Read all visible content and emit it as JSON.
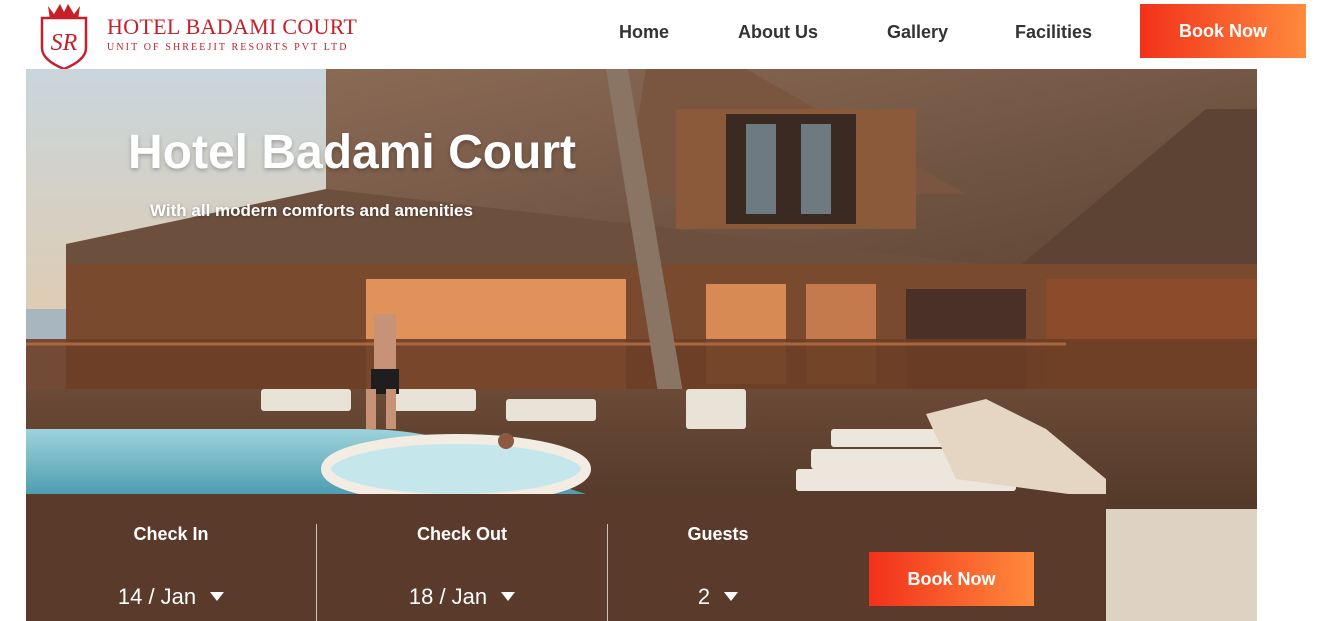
{
  "brand": {
    "name": "HOTEL BADAMI COURT",
    "tagline": "UNIT  OF SHREEJIT RESORTS PVT LTD",
    "logo_color": "#c8202a"
  },
  "nav": {
    "items": [
      {
        "label": "Home"
      },
      {
        "label": "About Us"
      },
      {
        "label": "Gallery"
      },
      {
        "label": "Facilities"
      }
    ],
    "book_label": "Book Now",
    "accent_color": "#f2311a"
  },
  "hero": {
    "title": "Hotel Badami Court",
    "subtitle": "With all modern comforts and amenities"
  },
  "booking": {
    "check_in": {
      "label": "Check In",
      "value": "14 / Jan"
    },
    "check_out": {
      "label": "Check Out",
      "value": "18 / Jan"
    },
    "guests": {
      "label": "Guests",
      "value": "2"
    },
    "book_label": "Book Now",
    "bar_color": "#5a3a2a"
  }
}
